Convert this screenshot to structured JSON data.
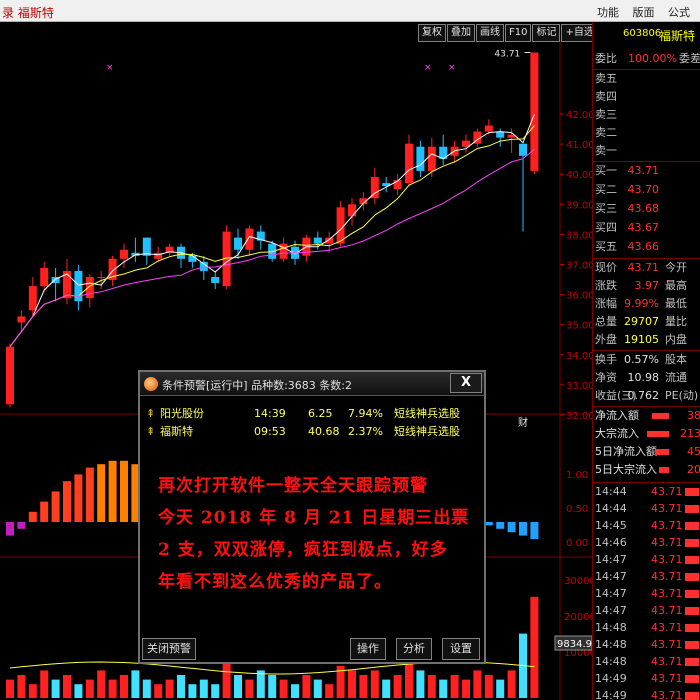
{
  "app": {
    "title": "录  福斯特",
    "menu": [
      "功能",
      "版面",
      "公式"
    ]
  },
  "toolbar": [
    "复权",
    "叠加",
    "画线",
    "F10",
    "标记",
    "+自选",
    "返回"
  ],
  "chart": {
    "price_axis": [
      "42.00",
      "41.00",
      "40.00",
      "39.00",
      "38.00",
      "37.00",
      "36.00",
      "35.00",
      "34.00",
      "33.00",
      "32.00"
    ],
    "high_label": "43.71",
    "macd_axis": [
      "1.00",
      "0.50",
      "0.00"
    ],
    "vol_axis": [
      "30000",
      "20000",
      "10000"
    ],
    "vol_box": "9834.99",
    "cai_label": "财",
    "colors": {
      "up": "#ff2020",
      "down": "#20c0ff",
      "ma1": "#ffffff",
      "ma2": "#ffff40",
      "ma3": "#ff40ff"
    }
  },
  "panel": {
    "code": "603806",
    "name": "福斯特",
    "weibi": {
      "label": "委比",
      "value": "100.00%",
      "label2": "委差"
    },
    "sells": [
      "卖五",
      "卖四",
      "卖三",
      "卖二",
      "卖一"
    ],
    "buys": [
      {
        "label": "买一",
        "price": "43.71"
      },
      {
        "label": "买二",
        "price": "43.70"
      },
      {
        "label": "买三",
        "price": "43.68"
      },
      {
        "label": "买四",
        "price": "43.67"
      },
      {
        "label": "买五",
        "price": "43.66"
      }
    ],
    "stats": [
      {
        "label": "现价",
        "value": "43.71",
        "label2": "今开"
      },
      {
        "label": "涨跌",
        "value": "3.97",
        "label2": "最高"
      },
      {
        "label": "涨幅",
        "value": "9.99%",
        "label2": "最低"
      },
      {
        "label": "总量",
        "value": "29707",
        "label2": "量比"
      },
      {
        "label": "外盘",
        "value": "19105",
        "label2": "内盘"
      }
    ],
    "stats2": [
      {
        "label": "换手",
        "value": "0.57%",
        "label2": "股本"
      },
      {
        "label": "净资",
        "value": "10.98",
        "label2": "流通"
      },
      {
        "label": "收益(三)",
        "value": "0.762",
        "label2": "PE(动)"
      }
    ],
    "flows": [
      {
        "label": "净流入额",
        "value": "38"
      },
      {
        "label": "大宗流入",
        "value": "213"
      },
      {
        "label": "5日净流入额",
        "value": "45"
      },
      {
        "label": "5日大宗流入",
        "value": "20"
      }
    ],
    "ticks": [
      {
        "time": "14:44",
        "price": "43.71"
      },
      {
        "time": "14:44",
        "price": "43.71"
      },
      {
        "time": "14:45",
        "price": "43.71"
      },
      {
        "time": "14:46",
        "price": "43.71"
      },
      {
        "time": "14:47",
        "price": "43.71"
      },
      {
        "time": "14:47",
        "price": "43.71"
      },
      {
        "time": "14:47",
        "price": "43.71"
      },
      {
        "time": "14:47",
        "price": "43.71"
      },
      {
        "time": "14:48",
        "price": "43.71"
      },
      {
        "time": "14:48",
        "price": "43.71"
      },
      {
        "time": "14:48",
        "price": "43.71"
      },
      {
        "time": "14:49",
        "price": "43.71"
      },
      {
        "time": "14:49",
        "price": "43.71"
      },
      {
        "time": "14:50",
        "price": "43.71"
      }
    ]
  },
  "popup": {
    "title": "条件预警[运行中] 品种数:3683 条数:2",
    "close": "X",
    "alerts": [
      {
        "name": "阳光股份",
        "time": "14:39",
        "price": "6.25",
        "pct": "7.94%",
        "strategy": "短线神兵选股"
      },
      {
        "name": "福斯特",
        "time": "09:53",
        "price": "40.68",
        "pct": "2.37%",
        "strategy": "短线神兵选股"
      }
    ],
    "message": [
      "再次打开软件一整天全天跟踪预警",
      "今天 2018 年 8 月 21 日星期三出票",
      "2 支，双双涨停，疯狂到极点，好多",
      "年看不到这么优秀的产品了。"
    ],
    "buttons": {
      "close_alert": "关闭预警",
      "operate": "操作",
      "analyze": "分析",
      "settings": "设置"
    }
  }
}
